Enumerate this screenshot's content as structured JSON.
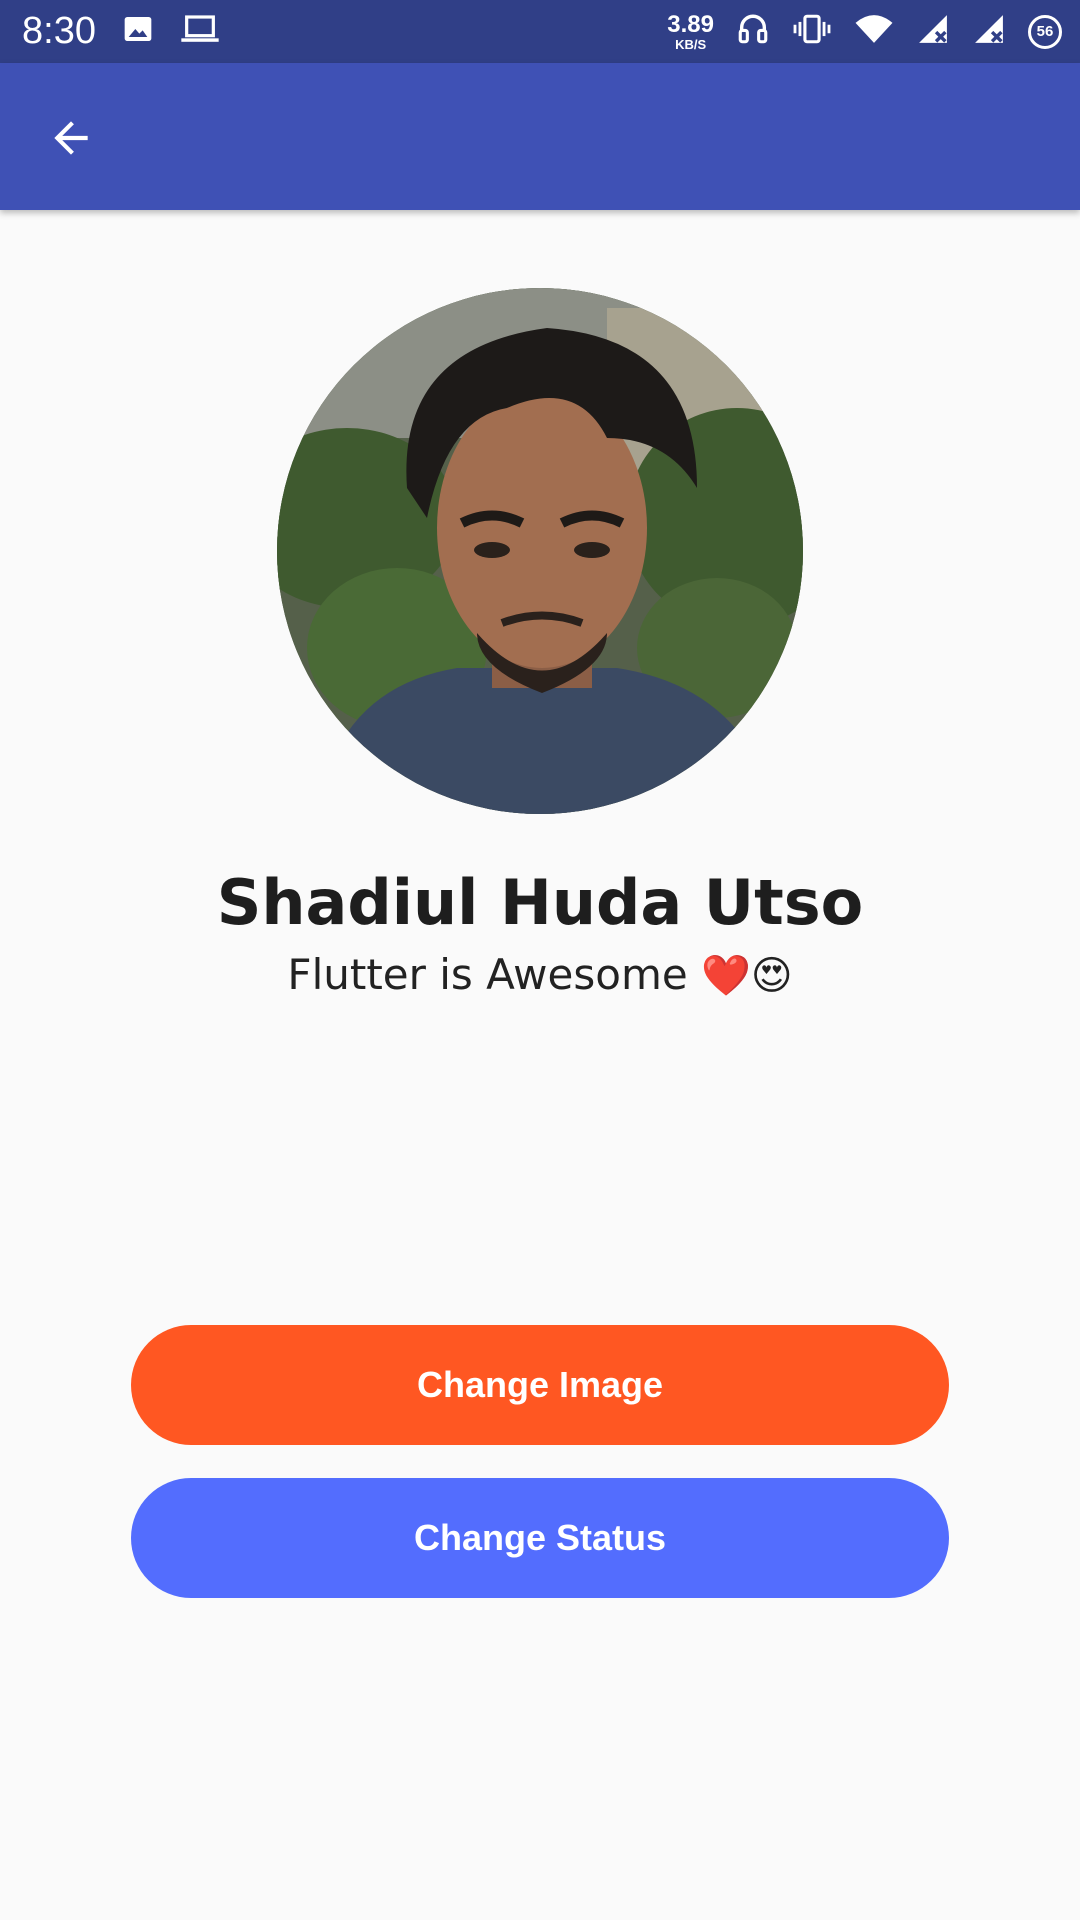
{
  "status_bar": {
    "time": "8:30",
    "net_speed_value": "3.89",
    "net_speed_unit": "KB/S",
    "battery_level": "56",
    "icons": [
      "image-icon",
      "laptop-icon",
      "headphones-icon",
      "vibrate-icon",
      "wifi-icon",
      "signal-icon",
      "signal-icon",
      "battery-icon"
    ]
  },
  "app_bar": {
    "back_icon": "arrow-left-icon",
    "color": "#3f51b5"
  },
  "profile": {
    "name": "Shadiul Huda Utso",
    "status_text": "Flutter is Awesome",
    "status_emoji": "❤️😍"
  },
  "buttons": {
    "change_image": "Change Image",
    "change_status": "Change Status"
  },
  "colors": {
    "status_bar": "#303f87",
    "app_bar": "#3f51b5",
    "change_image_button": "#ff5722",
    "change_status_button": "#536dfe",
    "background": "#fafafa"
  }
}
